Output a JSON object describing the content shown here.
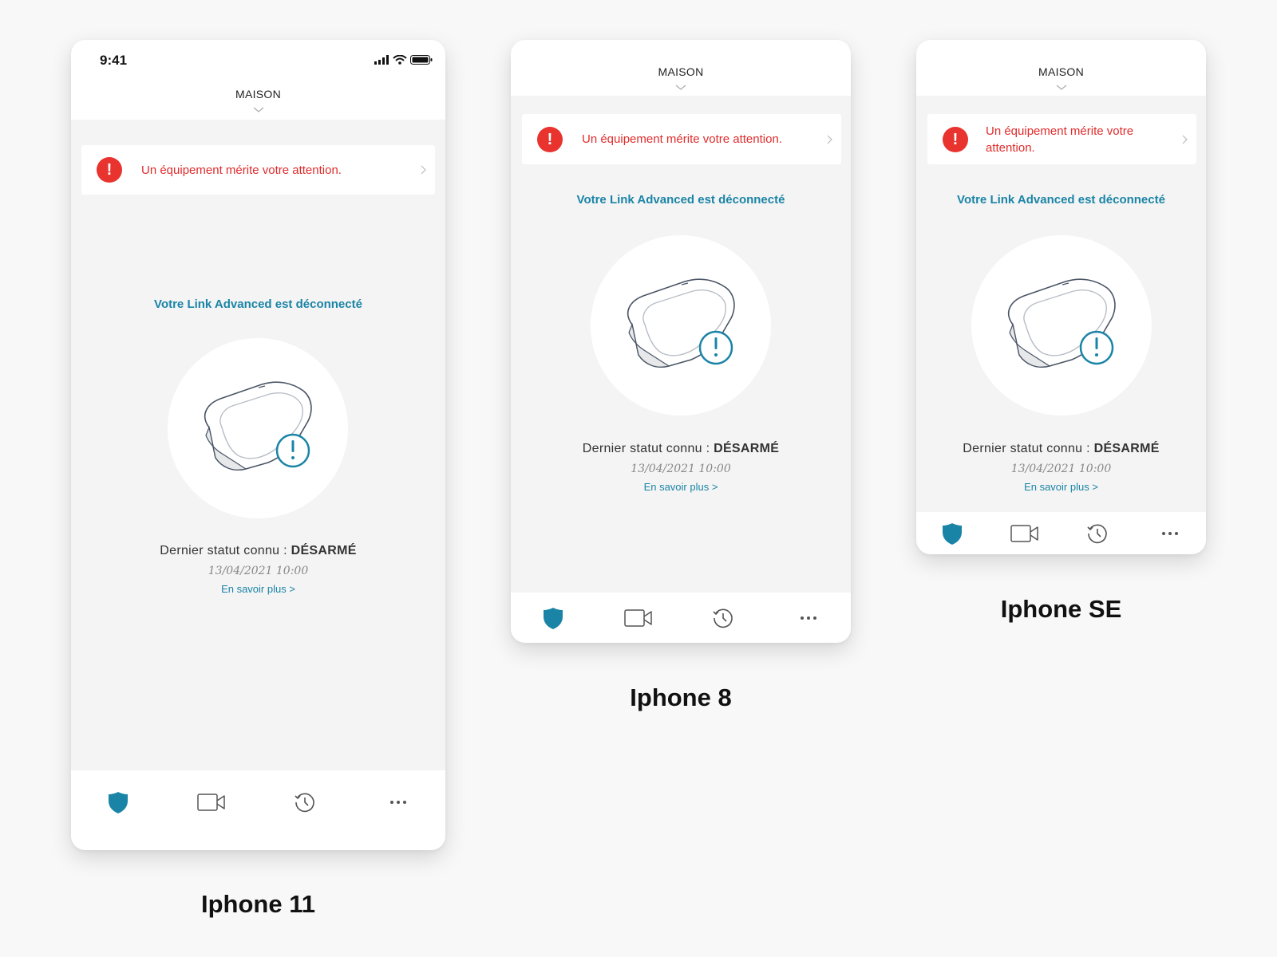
{
  "devices": [
    {
      "id": "p11",
      "caption": "Iphone 11",
      "status_time": "9:41",
      "title": "MAISON",
      "alert_text": "Un équipement mérite votre attention.",
      "disconnected_title": "Votre Link Advanced est déconnecté",
      "status_prefix": "Dernier statut connu : ",
      "status_value": "DÉSARMÉ",
      "date": "13/04/2021 10:00",
      "more_link": "En savoir plus >"
    },
    {
      "id": "p8",
      "caption": "Iphone 8",
      "title": "MAISON",
      "alert_text": "Un équipement mérite votre attention.",
      "disconnected_title": "Votre Link Advanced est déconnecté",
      "status_prefix": "Dernier statut connu : ",
      "status_value": "DÉSARMÉ",
      "date": "13/04/2021 10:00",
      "more_link": "En savoir plus >"
    },
    {
      "id": "pse",
      "caption": "Iphone SE",
      "title": "MAISON",
      "alert_text": "Un équipement mérite votre attention.",
      "disconnected_title": "Votre Link Advanced est déconnecté",
      "status_prefix": "Dernier statut connu : ",
      "status_value": "DÉSARMÉ",
      "date": "13/04/2021 10:00",
      "more_link": "En savoir plus >"
    }
  ],
  "tabs": [
    {
      "icon": "shield-icon",
      "active": true
    },
    {
      "icon": "video-camera-icon",
      "active": false
    },
    {
      "icon": "history-icon",
      "active": false
    },
    {
      "icon": "more-icon",
      "active": false
    }
  ],
  "colors": {
    "accent": "#1a84a6",
    "alert": "#e12b2b",
    "alert_badge": "#e8332f",
    "background": "#f4f4f4"
  }
}
